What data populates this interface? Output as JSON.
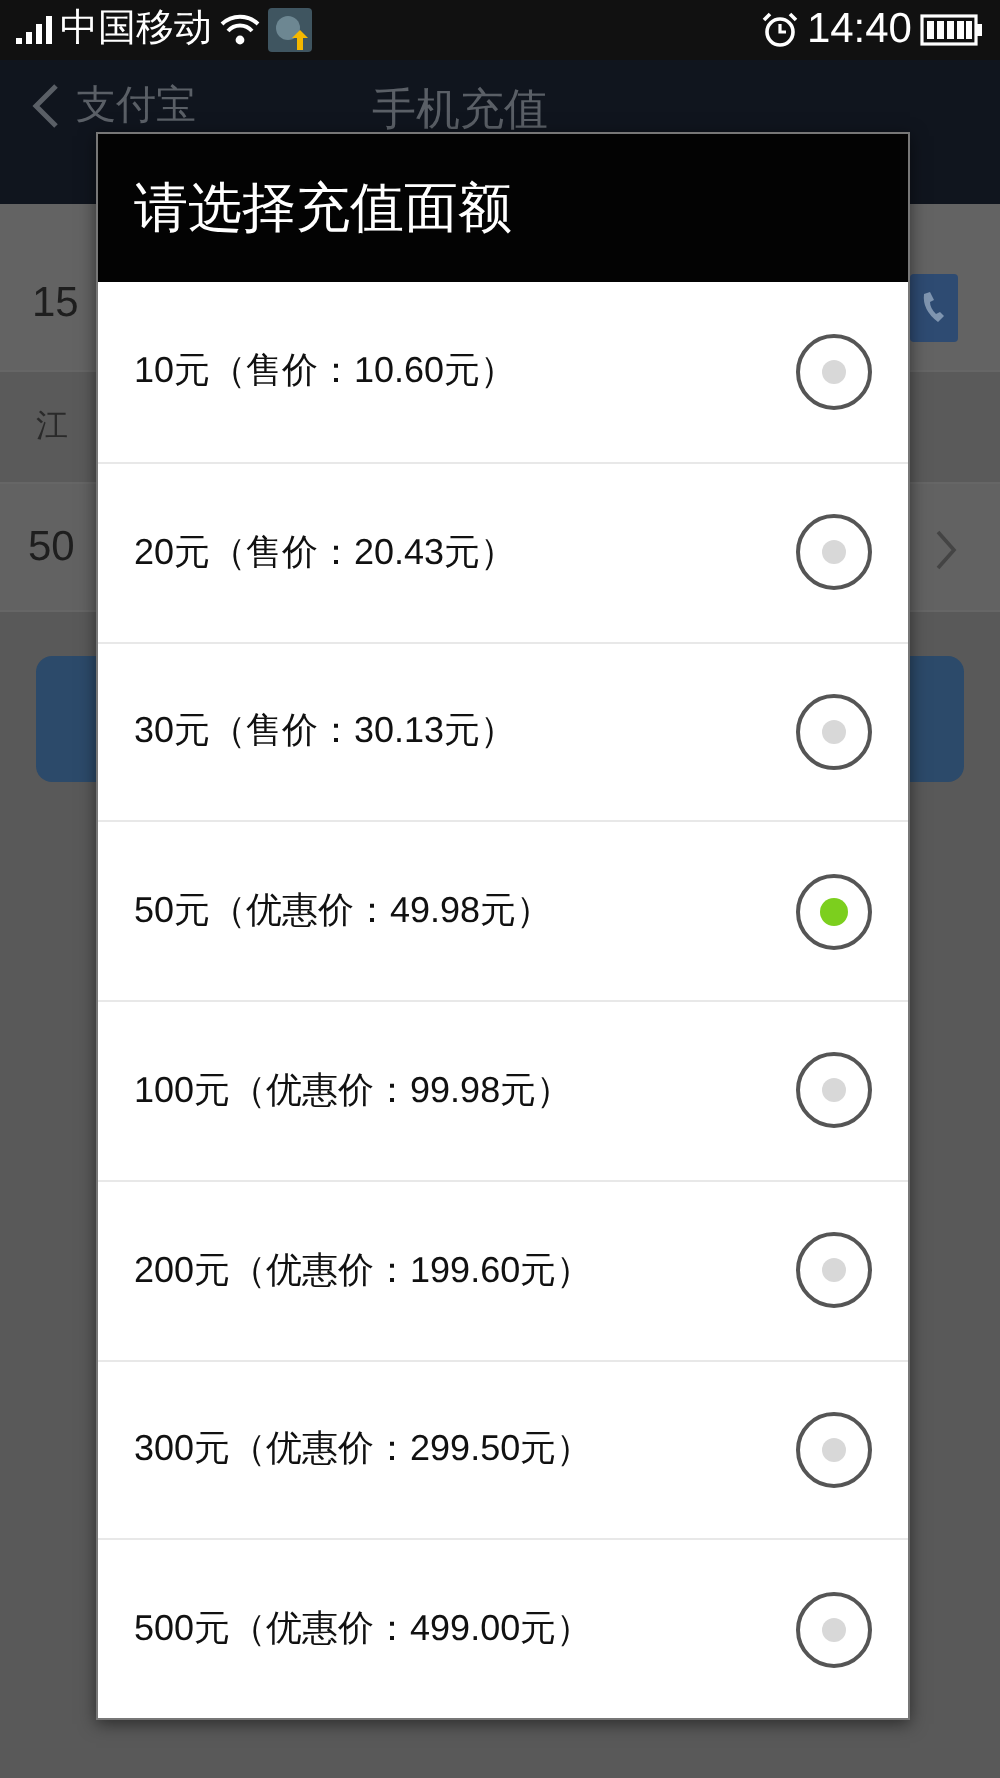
{
  "status_bar": {
    "carrier": "中国移动",
    "time": "14:40"
  },
  "header": {
    "back_label": "支付宝",
    "title": "手机充值"
  },
  "background": {
    "phone_number": "15",
    "region": "江",
    "amount": "50"
  },
  "dialog": {
    "title": "请选择充值面额",
    "options": [
      {
        "label": "10元（售价：10.60元）",
        "selected": false
      },
      {
        "label": "20元（售价：20.43元）",
        "selected": false
      },
      {
        "label": "30元（售价：30.13元）",
        "selected": false
      },
      {
        "label": "50元（优惠价：49.98元）",
        "selected": true
      },
      {
        "label": "100元（优惠价：99.98元）",
        "selected": false
      },
      {
        "label": "200元（优惠价：199.60元）",
        "selected": false
      },
      {
        "label": "300元（优惠价：299.50元）",
        "selected": false
      },
      {
        "label": "500元（优惠价：499.00元）",
        "selected": false
      }
    ]
  }
}
